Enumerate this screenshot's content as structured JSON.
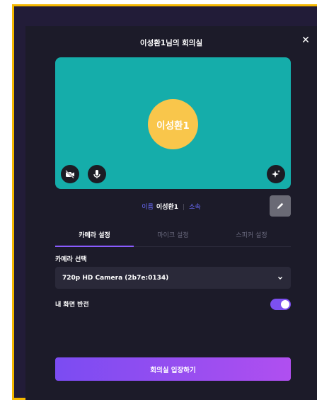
{
  "modal": {
    "title": "이성환1님의 회의실",
    "close_icon": "close-icon"
  },
  "preview": {
    "avatar_text": "이성환1",
    "camera_off_icon": "camera-off-icon",
    "mic_icon": "microphone-icon",
    "effects_icon": "sparkle-icon"
  },
  "profile": {
    "name_label": "이름",
    "name_value": "이성환1",
    "affiliation_label": "소속",
    "edit_icon": "pencil-icon"
  },
  "tabs": [
    {
      "label": "카메라 설정",
      "active": true
    },
    {
      "label": "마이크 설정",
      "active": false
    },
    {
      "label": "스피커 설정",
      "active": false
    }
  ],
  "camera": {
    "select_label": "카메라 선택",
    "selected_value": "720p HD Camera (2b7e:0134)",
    "chevron_icon": "chevron-down-icon",
    "mirror_label": "내 화면 반전",
    "mirror_enabled": true
  },
  "actions": {
    "enter_label": "회의실 입장하기"
  },
  "colors": {
    "accent": "#7c50f0",
    "preview_bg": "#15adaa",
    "avatar_bg": "#f9c64b",
    "modal_bg": "#1c1b29"
  }
}
